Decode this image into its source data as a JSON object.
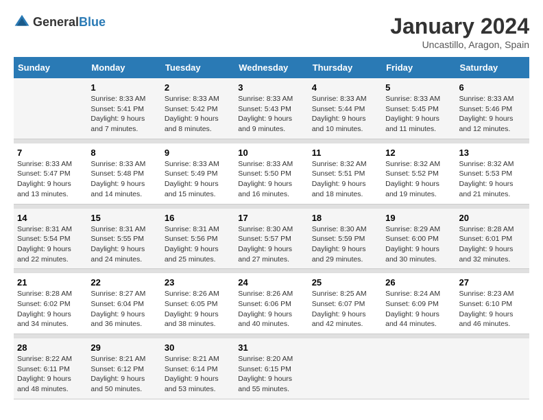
{
  "logo": {
    "general": "General",
    "blue": "Blue"
  },
  "title": "January 2024",
  "subtitle": "Uncastillo, Aragon, Spain",
  "days_of_week": [
    "Sunday",
    "Monday",
    "Tuesday",
    "Wednesday",
    "Thursday",
    "Friday",
    "Saturday"
  ],
  "weeks": [
    [
      {
        "num": "",
        "sunrise": "",
        "sunset": "",
        "daylight": ""
      },
      {
        "num": "1",
        "sunrise": "Sunrise: 8:33 AM",
        "sunset": "Sunset: 5:41 PM",
        "daylight": "Daylight: 9 hours and 7 minutes."
      },
      {
        "num": "2",
        "sunrise": "Sunrise: 8:33 AM",
        "sunset": "Sunset: 5:42 PM",
        "daylight": "Daylight: 9 hours and 8 minutes."
      },
      {
        "num": "3",
        "sunrise": "Sunrise: 8:33 AM",
        "sunset": "Sunset: 5:43 PM",
        "daylight": "Daylight: 9 hours and 9 minutes."
      },
      {
        "num": "4",
        "sunrise": "Sunrise: 8:33 AM",
        "sunset": "Sunset: 5:44 PM",
        "daylight": "Daylight: 9 hours and 10 minutes."
      },
      {
        "num": "5",
        "sunrise": "Sunrise: 8:33 AM",
        "sunset": "Sunset: 5:45 PM",
        "daylight": "Daylight: 9 hours and 11 minutes."
      },
      {
        "num": "6",
        "sunrise": "Sunrise: 8:33 AM",
        "sunset": "Sunset: 5:46 PM",
        "daylight": "Daylight: 9 hours and 12 minutes."
      }
    ],
    [
      {
        "num": "7",
        "sunrise": "Sunrise: 8:33 AM",
        "sunset": "Sunset: 5:47 PM",
        "daylight": "Daylight: 9 hours and 13 minutes."
      },
      {
        "num": "8",
        "sunrise": "Sunrise: 8:33 AM",
        "sunset": "Sunset: 5:48 PM",
        "daylight": "Daylight: 9 hours and 14 minutes."
      },
      {
        "num": "9",
        "sunrise": "Sunrise: 8:33 AM",
        "sunset": "Sunset: 5:49 PM",
        "daylight": "Daylight: 9 hours and 15 minutes."
      },
      {
        "num": "10",
        "sunrise": "Sunrise: 8:33 AM",
        "sunset": "Sunset: 5:50 PM",
        "daylight": "Daylight: 9 hours and 16 minutes."
      },
      {
        "num": "11",
        "sunrise": "Sunrise: 8:32 AM",
        "sunset": "Sunset: 5:51 PM",
        "daylight": "Daylight: 9 hours and 18 minutes."
      },
      {
        "num": "12",
        "sunrise": "Sunrise: 8:32 AM",
        "sunset": "Sunset: 5:52 PM",
        "daylight": "Daylight: 9 hours and 19 minutes."
      },
      {
        "num": "13",
        "sunrise": "Sunrise: 8:32 AM",
        "sunset": "Sunset: 5:53 PM",
        "daylight": "Daylight: 9 hours and 21 minutes."
      }
    ],
    [
      {
        "num": "14",
        "sunrise": "Sunrise: 8:31 AM",
        "sunset": "Sunset: 5:54 PM",
        "daylight": "Daylight: 9 hours and 22 minutes."
      },
      {
        "num": "15",
        "sunrise": "Sunrise: 8:31 AM",
        "sunset": "Sunset: 5:55 PM",
        "daylight": "Daylight: 9 hours and 24 minutes."
      },
      {
        "num": "16",
        "sunrise": "Sunrise: 8:31 AM",
        "sunset": "Sunset: 5:56 PM",
        "daylight": "Daylight: 9 hours and 25 minutes."
      },
      {
        "num": "17",
        "sunrise": "Sunrise: 8:30 AM",
        "sunset": "Sunset: 5:57 PM",
        "daylight": "Daylight: 9 hours and 27 minutes."
      },
      {
        "num": "18",
        "sunrise": "Sunrise: 8:30 AM",
        "sunset": "Sunset: 5:59 PM",
        "daylight": "Daylight: 9 hours and 29 minutes."
      },
      {
        "num": "19",
        "sunrise": "Sunrise: 8:29 AM",
        "sunset": "Sunset: 6:00 PM",
        "daylight": "Daylight: 9 hours and 30 minutes."
      },
      {
        "num": "20",
        "sunrise": "Sunrise: 8:28 AM",
        "sunset": "Sunset: 6:01 PM",
        "daylight": "Daylight: 9 hours and 32 minutes."
      }
    ],
    [
      {
        "num": "21",
        "sunrise": "Sunrise: 8:28 AM",
        "sunset": "Sunset: 6:02 PM",
        "daylight": "Daylight: 9 hours and 34 minutes."
      },
      {
        "num": "22",
        "sunrise": "Sunrise: 8:27 AM",
        "sunset": "Sunset: 6:04 PM",
        "daylight": "Daylight: 9 hours and 36 minutes."
      },
      {
        "num": "23",
        "sunrise": "Sunrise: 8:26 AM",
        "sunset": "Sunset: 6:05 PM",
        "daylight": "Daylight: 9 hours and 38 minutes."
      },
      {
        "num": "24",
        "sunrise": "Sunrise: 8:26 AM",
        "sunset": "Sunset: 6:06 PM",
        "daylight": "Daylight: 9 hours and 40 minutes."
      },
      {
        "num": "25",
        "sunrise": "Sunrise: 8:25 AM",
        "sunset": "Sunset: 6:07 PM",
        "daylight": "Daylight: 9 hours and 42 minutes."
      },
      {
        "num": "26",
        "sunrise": "Sunrise: 8:24 AM",
        "sunset": "Sunset: 6:09 PM",
        "daylight": "Daylight: 9 hours and 44 minutes."
      },
      {
        "num": "27",
        "sunrise": "Sunrise: 8:23 AM",
        "sunset": "Sunset: 6:10 PM",
        "daylight": "Daylight: 9 hours and 46 minutes."
      }
    ],
    [
      {
        "num": "28",
        "sunrise": "Sunrise: 8:22 AM",
        "sunset": "Sunset: 6:11 PM",
        "daylight": "Daylight: 9 hours and 48 minutes."
      },
      {
        "num": "29",
        "sunrise": "Sunrise: 8:21 AM",
        "sunset": "Sunset: 6:12 PM",
        "daylight": "Daylight: 9 hours and 50 minutes."
      },
      {
        "num": "30",
        "sunrise": "Sunrise: 8:21 AM",
        "sunset": "Sunset: 6:14 PM",
        "daylight": "Daylight: 9 hours and 53 minutes."
      },
      {
        "num": "31",
        "sunrise": "Sunrise: 8:20 AM",
        "sunset": "Sunset: 6:15 PM",
        "daylight": "Daylight: 9 hours and 55 minutes."
      },
      {
        "num": "",
        "sunrise": "",
        "sunset": "",
        "daylight": ""
      },
      {
        "num": "",
        "sunrise": "",
        "sunset": "",
        "daylight": ""
      },
      {
        "num": "",
        "sunrise": "",
        "sunset": "",
        "daylight": ""
      }
    ]
  ]
}
